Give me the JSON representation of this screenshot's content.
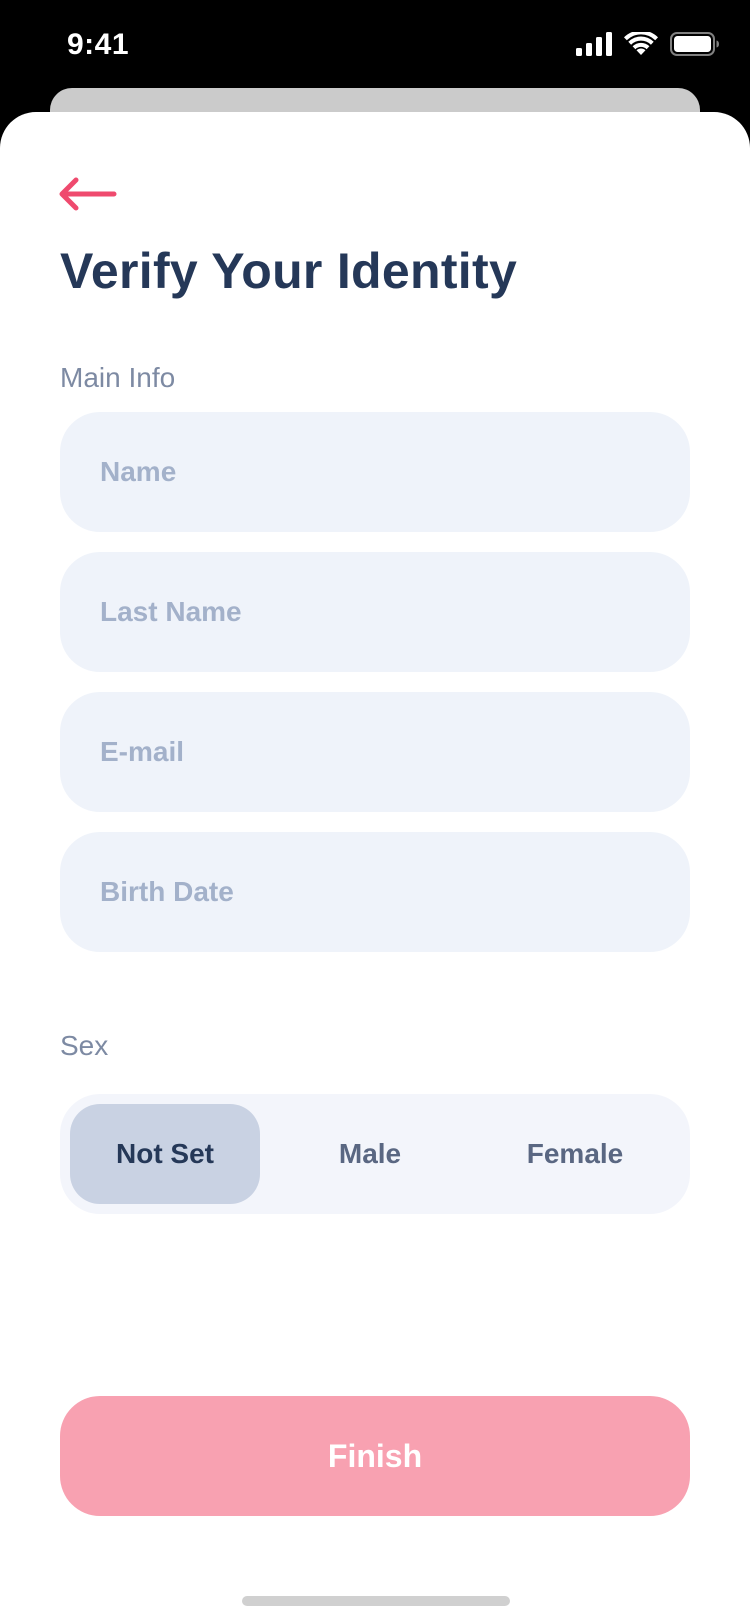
{
  "status_bar": {
    "time": "9:41",
    "icons": [
      "cellular-signal-icon",
      "wifi-icon",
      "battery-icon"
    ]
  },
  "header": {
    "back_icon": "arrow-left-icon",
    "title": "Verify Your Identity"
  },
  "main_info": {
    "label": "Main Info",
    "fields": [
      {
        "name": "name-input",
        "value": "",
        "placeholder": "Name"
      },
      {
        "name": "last-name-input",
        "value": "",
        "placeholder": "Last Name"
      },
      {
        "name": "email-input",
        "value": "",
        "placeholder": "E-mail"
      },
      {
        "name": "birth-date-input",
        "value": "",
        "placeholder": "Birth Date"
      }
    ]
  },
  "sex": {
    "label": "Sex",
    "options": [
      "Not Set",
      "Male",
      "Female"
    ],
    "selected": "Not Set"
  },
  "actions": {
    "finish_label": "Finish"
  },
  "colors": {
    "accent": "#ef4a6e",
    "title": "#253858",
    "label": "#7d8aa3",
    "field_bg": "#eff3fa",
    "placeholder": "#a3b1ca",
    "segment_selected_bg": "#c9d2e3",
    "finish_button_bg": "#f8a1b1"
  }
}
